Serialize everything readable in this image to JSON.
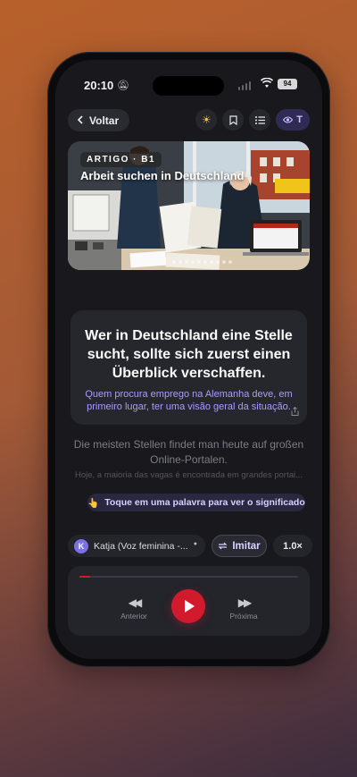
{
  "status_bar": {
    "time": "20:10",
    "battery": "94"
  },
  "toolbar": {
    "back_label": "Voltar",
    "translation_toggle_label": "T"
  },
  "article": {
    "tag": "ARTIGO · B1",
    "title": "Arbeit suchen in Deutschland"
  },
  "current_sentence": {
    "german": "Wer in Deutschland eine Stelle sucht, sollte sich zuerst einen Überblick verschaffen.",
    "portuguese": "Quem procura emprego na Alemanha deve, em primeiro lugar, ter uma visão geral da situação."
  },
  "next_sentence": {
    "german": "Die meisten Stellen findet man heute auf großen Online-Portalen.",
    "portuguese": "Hoje, a maioria das vagas é encontrada em grandes portai..."
  },
  "hint": {
    "emoji": "👆",
    "text": "Toque em uma palavra para ver o significado"
  },
  "controls": {
    "voice_initial": "K",
    "voice_label": "Katja (Voz feminina -...",
    "imitate_label": "Imitar",
    "speed_label": "1.0×"
  },
  "player": {
    "progress": 0.05,
    "previous_label": "Anterior",
    "next_label": "Próxima"
  },
  "colors": {
    "accent": "#d11b2d",
    "highlight": "#a99cff",
    "background": "#19191d"
  }
}
